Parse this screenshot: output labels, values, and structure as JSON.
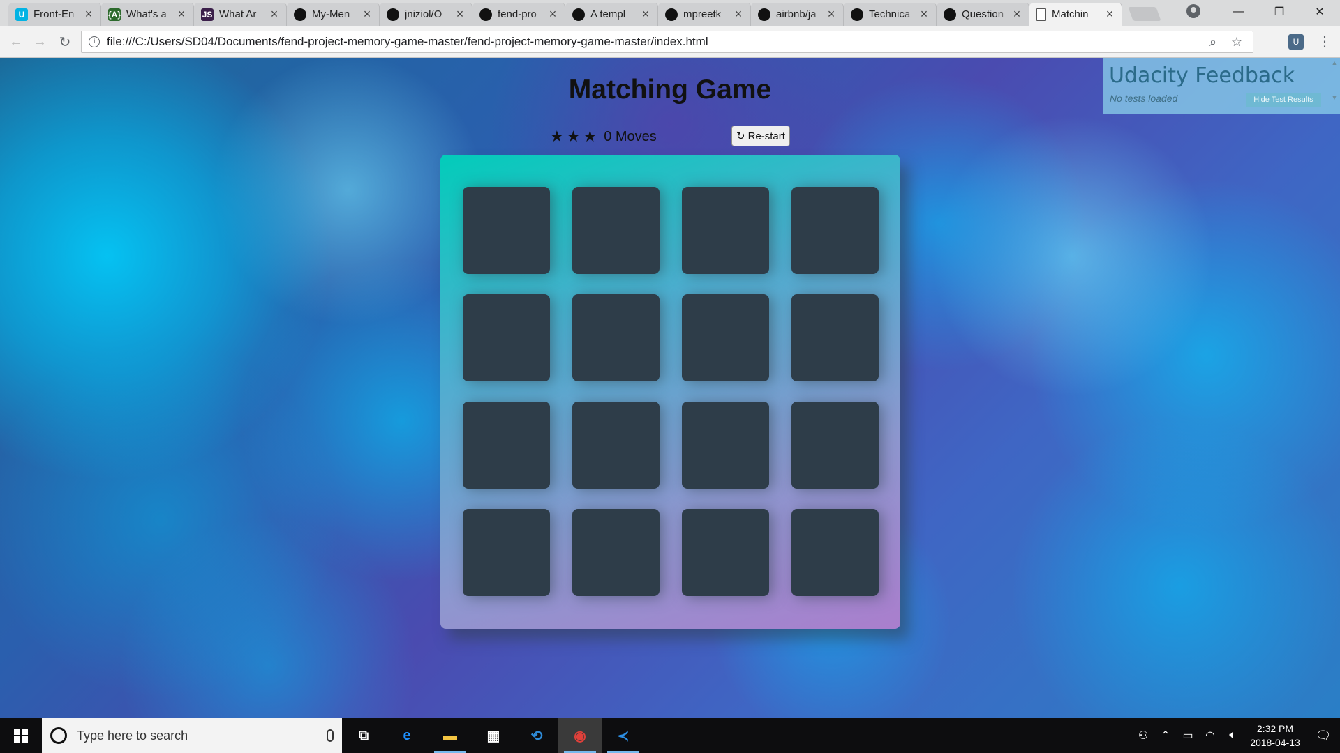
{
  "browser": {
    "tabs": [
      {
        "title": "Front-En",
        "icon": "udacity-icon",
        "icon_text": "U",
        "icon_color": "#02b3e4",
        "active": false
      },
      {
        "title": "What's a",
        "icon": "code-icon",
        "icon_text": "{A}",
        "icon_color": "#2d6a2d",
        "active": false
      },
      {
        "title": "What Ar",
        "icon": "js-icon",
        "icon_text": "JS",
        "icon_color": "#3b1f4a",
        "active": false
      },
      {
        "title": "My-Men",
        "icon": "github-icon",
        "icon_text": "",
        "icon_color": "#111111",
        "active": false
      },
      {
        "title": "jniziol/O",
        "icon": "github-icon",
        "icon_text": "",
        "icon_color": "#111111",
        "active": false
      },
      {
        "title": "fend-pro",
        "icon": "github-icon",
        "icon_text": "",
        "icon_color": "#111111",
        "active": false
      },
      {
        "title": "A templ",
        "icon": "github-icon",
        "icon_text": "",
        "icon_color": "#111111",
        "active": false
      },
      {
        "title": "mpreetk",
        "icon": "github-icon",
        "icon_text": "",
        "icon_color": "#111111",
        "active": false
      },
      {
        "title": "airbnb/ja",
        "icon": "github-icon",
        "icon_text": "",
        "icon_color": "#111111",
        "active": false
      },
      {
        "title": "Technica",
        "icon": "github-icon",
        "icon_text": "",
        "icon_color": "#111111",
        "active": false
      },
      {
        "title": "Question",
        "icon": "github-icon",
        "icon_text": "",
        "icon_color": "#111111",
        "active": false
      },
      {
        "title": "Matchin",
        "icon": "page-icon",
        "icon_text": "",
        "icon_color": "#ffffff",
        "active": true
      }
    ],
    "url": "file:///C:/Users/SD04/Documents/fend-project-memory-game-master/fend-project-memory-game-master/index.html"
  },
  "page": {
    "title": "Matching Game",
    "stars": [
      "★",
      "★",
      "★"
    ],
    "moves_count": "0",
    "moves_label": "Moves",
    "restart_label": "Re-start",
    "restart_icon": "↻",
    "card_count": 16
  },
  "feedback": {
    "title": "Udacity Feedback",
    "subtitle": "No tests loaded",
    "button": "Hide Test Results"
  },
  "taskbar": {
    "search_placeholder": "Type here to search",
    "apps": [
      {
        "name": "task-view",
        "glyph": "⧉",
        "color": "#ffffff",
        "running": false
      },
      {
        "name": "edge",
        "glyph": "e",
        "color": "#1e90ff",
        "running": false
      },
      {
        "name": "file-explorer",
        "glyph": "▬",
        "color": "#f4c542",
        "running": true
      },
      {
        "name": "store",
        "glyph": "▦",
        "color": "#ffffff",
        "running": false
      },
      {
        "name": "app-blue",
        "glyph": "⟲",
        "color": "#2e8bd8",
        "running": false
      },
      {
        "name": "chrome",
        "glyph": "◉",
        "color": "#e0403a",
        "running": true,
        "active": true
      },
      {
        "name": "vscode",
        "glyph": "≺",
        "color": "#2c8ee3",
        "running": true
      }
    ],
    "time": "2:32 PM",
    "date": "2018-04-13"
  }
}
